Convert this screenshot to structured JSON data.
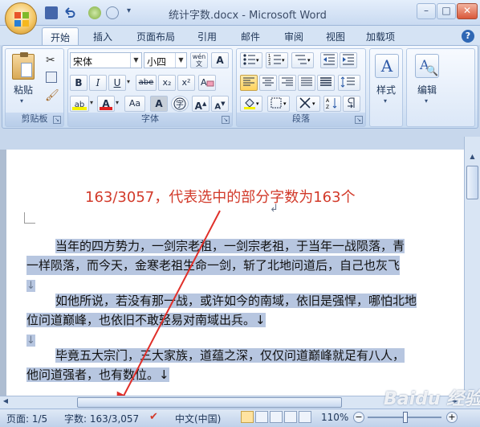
{
  "window": {
    "title": "统计字数.docx - Microsoft Word",
    "min_label": "–",
    "max_label": "□",
    "close_label": "✕"
  },
  "tabs": [
    {
      "label": "开始",
      "active": true
    },
    {
      "label": "插入"
    },
    {
      "label": "页面布局"
    },
    {
      "label": "引用"
    },
    {
      "label": "邮件"
    },
    {
      "label": "审阅"
    },
    {
      "label": "视图"
    },
    {
      "label": "加载项"
    }
  ],
  "help_label": "?",
  "ribbon": {
    "clipboard": {
      "label": "剪贴板",
      "paste_label": "粘贴"
    },
    "font": {
      "label": "字体",
      "font_name": "宋体",
      "font_size": "小四",
      "wen_label": "wén",
      "bold": "B",
      "italic": "I",
      "underline": "U",
      "strike": "abe",
      "sub": "x₂",
      "sup": "x²",
      "aa": "Aa",
      "a_char": "A",
      "grow": "A",
      "shrink": "A",
      "ab": "ab",
      "font_color": "A"
    },
    "paragraph": {
      "label": "段落"
    },
    "styles": {
      "label": "样式",
      "icon_letter": "A"
    },
    "editing": {
      "label": "编辑",
      "icon_letter": "A"
    }
  },
  "document": {
    "annotation": "163/3057，代表选中的部分字数为163个",
    "lines": [
      {
        "text": "当年的四方势力，一剑宗老祖，一剑宗老祖，于当年一战陨落，青",
        "indent": true,
        "selected": true
      },
      {
        "text": "一样陨落，而今天，金寒老祖生命一剑，斩了北地问道后，自己也灰飞",
        "indent": false,
        "selected": true
      },
      {
        "text": "↓",
        "indent": false,
        "selected": true
      },
      {
        "text": "如他所说，若没有那一战，或许如今的南域，依旧是强悍，哪怕北地",
        "indent": true,
        "selected": true
      },
      {
        "text": "位问道巅峰，也依旧不敢轻易对南域出兵。↓",
        "indent": false,
        "selected": true
      },
      {
        "text": "↓",
        "indent": false,
        "selected": true
      },
      {
        "text": "毕竟五大宗门，三大家族，道蕴之深，仅仅问道巅峰就足有八人，",
        "indent": true,
        "selected": true
      },
      {
        "text": "他问道强者，也有数位。↓",
        "indent": false,
        "selected": true
      }
    ]
  },
  "status": {
    "page": "页面: 1/5",
    "words": "字数: 163/3,057",
    "language": "中文(中国)",
    "zoom": "110%"
  },
  "watermark": "Baidu 经验"
}
